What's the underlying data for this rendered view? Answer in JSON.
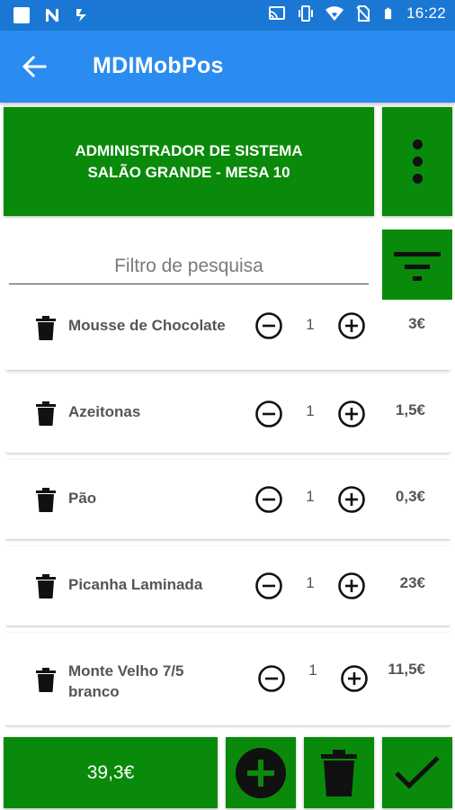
{
  "statusbar": {
    "time": "16:22",
    "icons": [
      "notification-square-icon",
      "n-icon",
      "app-icon",
      "cast-icon",
      "vibrate-icon",
      "wifi-icon",
      "no-sim-icon",
      "battery-icon"
    ]
  },
  "appbar": {
    "title": "MDIMobPos",
    "back_icon": "arrow-left-icon"
  },
  "header": {
    "line1": "ADMINISTRADOR DE SISTEMA",
    "line2": "SALÃO GRANDE - MESA  10",
    "menu_icon": "more-vertical-icon"
  },
  "search": {
    "placeholder": "Filtro de pesquisa",
    "value": "",
    "filter_icon": "filter-icon"
  },
  "items": [
    {
      "name": "Mousse de Chocolate",
      "qty": "1",
      "price": "3€"
    },
    {
      "name": "Azeitonas",
      "qty": "1",
      "price": "1,5€"
    },
    {
      "name": "Pão",
      "qty": "1",
      "price": "0,3€"
    },
    {
      "name": "Picanha Laminada",
      "qty": "1",
      "price": "23€"
    },
    {
      "name": "Monte Velho 7/5 branco",
      "qty": "1",
      "price": "11,5€"
    }
  ],
  "footer": {
    "total": "39,3€",
    "add_icon": "plus-circle-icon",
    "delete_icon": "trash-icon",
    "confirm_icon": "check-icon"
  },
  "colors": {
    "status_bar": "#1a78d4",
    "app_bar": "#2a8cf0",
    "accent_green": "#0a8a0a"
  }
}
